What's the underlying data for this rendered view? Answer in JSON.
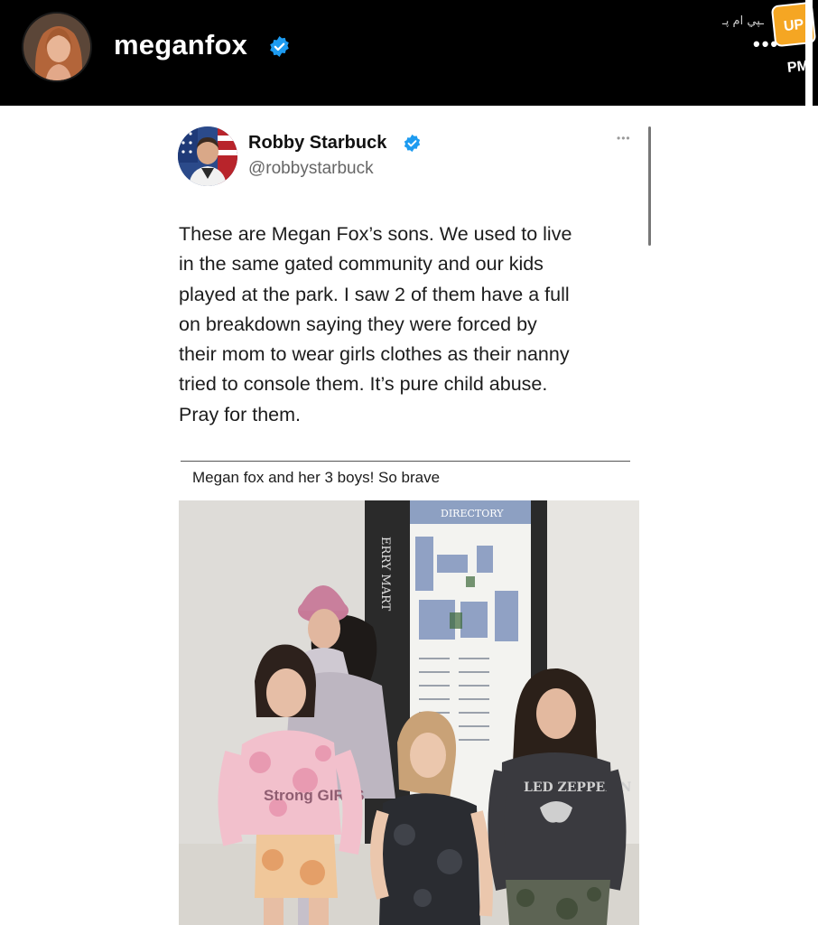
{
  "story_header": {
    "username": "meganfox",
    "verified": true,
    "more_label": "•••",
    "watermark_logo": "UP PM"
  },
  "tweet": {
    "author_name": "Robby Starbuck",
    "author_handle": "@robbystarbuck",
    "verified": true,
    "more_label": "•••",
    "text_lines": [
      "These are Megan Fox’s sons. We used to live",
      "in the same gated community and our kids",
      "played at the park. I saw 2 of them have a full",
      "on breakdown saying they were forced by",
      "their mom to wear girls clothes as their nanny",
      "tried to console them. It’s pure child abuse.",
      "Pray for them."
    ],
    "quoted_caption": "Megan fox and her 3 boys! So brave"
  },
  "photo": {
    "sign_header": "DIRECTORY",
    "sign_side_text": "ERRY MART",
    "shirt_left_text": "Strong GIRLS",
    "shirt_right_text": "LED ZEPPELIN"
  },
  "colors": {
    "header_bg": "#000000",
    "verified_blue": "#1d9bf0",
    "text_dark": "#1c1c1c",
    "text_muted": "#666666"
  }
}
